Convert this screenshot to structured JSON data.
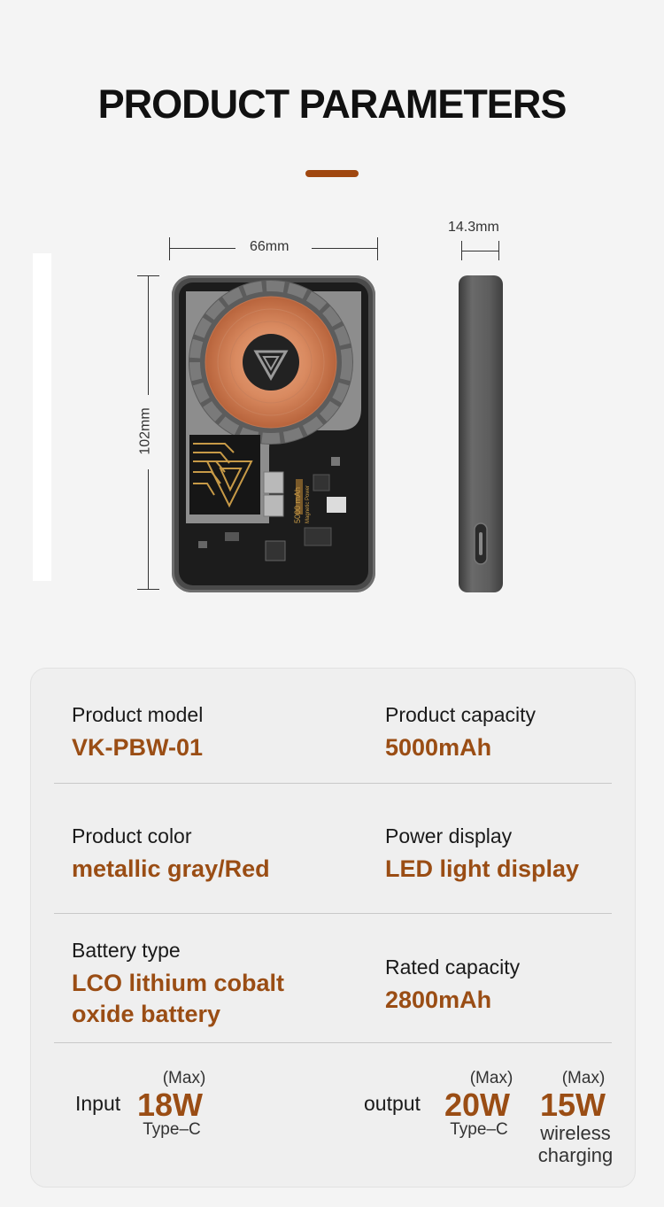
{
  "title": "PRODUCT PARAMETERS",
  "dimensions": {
    "width": "66mm",
    "height": "102mm",
    "thickness": "14.3mm"
  },
  "device_print": {
    "capacity": "5000 mAh",
    "brand_line": "Magnetic Power"
  },
  "specs": {
    "model_label": "Product model",
    "model_value": "VK-PBW-01",
    "capacity_label": "Product capacity",
    "capacity_value": "5000mAh",
    "color_label": "Product color",
    "color_value": "metallic gray/Red",
    "display_label": "Power display",
    "display_value": "LED light display",
    "battery_label": "Battery type",
    "battery_value_line1": "LCO lithium cobalt",
    "battery_value_line2": "oxide battery",
    "rated_label": "Rated capacity",
    "rated_value": "2800mAh"
  },
  "power": {
    "input_label": "Input",
    "input_max": "(Max)",
    "input_value": "18W",
    "input_port": "Type–C",
    "output_label": "output",
    "output_max": "(Max)",
    "output_value": "20W",
    "output_port": "Type–C",
    "wireless_max": "(Max)",
    "wireless_value": "15W",
    "wireless_line1": "wireless",
    "wireless_line2": "charging"
  },
  "colors": {
    "accent": "#a0470f",
    "value_text": "#9a4d14"
  }
}
